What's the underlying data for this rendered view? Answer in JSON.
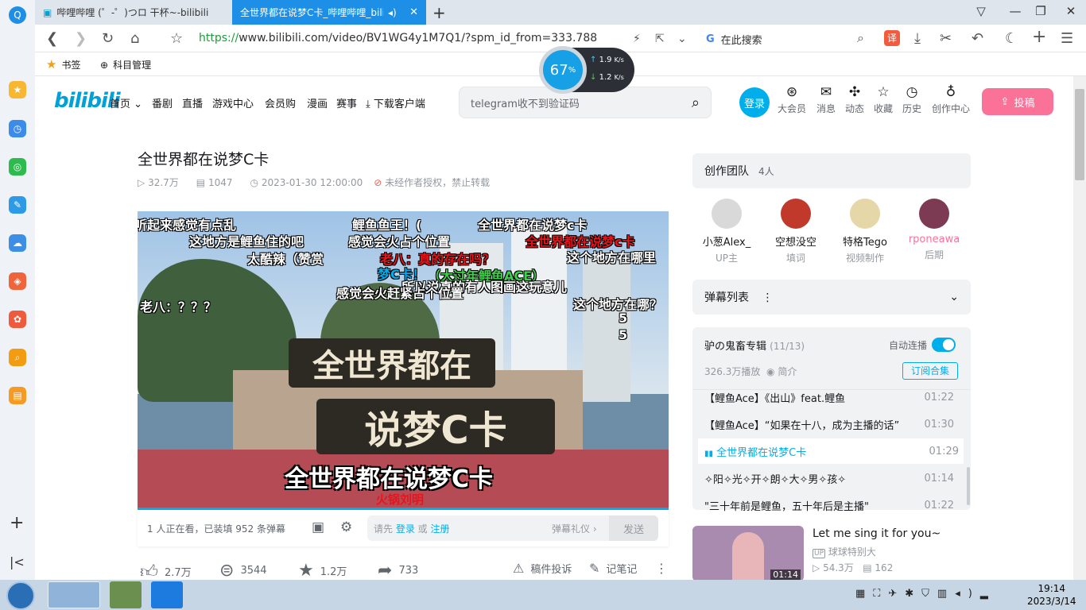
{
  "browser": {
    "tabs": [
      {
        "label": "哔哩哔哩 (゜-゜)つロ 干杯~-bilibili"
      },
      {
        "label": "全世界都在说梦C卡_哔哩哔哩_bilibili"
      }
    ],
    "url_prefix": "https://",
    "url_domain": "www.bilibili.com",
    "url_path": "/video/BV1WG4y1M7Q1/?spm_id_from=333.788",
    "search_placeholder": "在此搜索",
    "bookmarks": [
      {
        "label": "书签"
      },
      {
        "label": "科目管理"
      }
    ],
    "net_widget": {
      "percent": "67",
      "percent_sign": "%",
      "up": "1.9",
      "down": "1.2",
      "unit": "K/s"
    }
  },
  "bili_header": {
    "logo": "bilibili",
    "nav": [
      "首页",
      "番剧",
      "直播",
      "游戏中心",
      "会员购",
      "漫画",
      "赛事",
      "下载客户端"
    ],
    "search_placeholder": "telegram收不到验证码",
    "login": "登录",
    "icons": [
      "大会员",
      "消息",
      "动态",
      "收藏",
      "历史",
      "创作中心"
    ],
    "upload": "投稿"
  },
  "video": {
    "title": "全世界都在说梦C卡",
    "views": "32.7万",
    "danmaku_count": "1047",
    "date": "2023-01-30 12:00:00",
    "copyright": "未经作者授权，禁止转载",
    "danmaku": [
      {
        "text": "听起来感觉有点乱",
        "color": "#ffffff"
      },
      {
        "text": "鲤鱼鱼王！(",
        "color": "#ffffff"
      },
      {
        "text": "全世界都在说梦c卡",
        "color": "#ffffff"
      },
      {
        "text": "这地方是鲤鱼住的吧",
        "color": "#ffffff"
      },
      {
        "text": "感觉会火占个位置",
        "color": "#ffffff"
      },
      {
        "text": "全世界都在说梦c卡",
        "color": "#e8141b"
      },
      {
        "text": "太酷辣（赞赏",
        "color": "#ffffff"
      },
      {
        "text": "老八：真的存在吗？",
        "color": "#e8141b"
      },
      {
        "text": "这个地方在哪里",
        "color": "#ffffff"
      },
      {
        "text": "梦C卡！",
        "color": "#00aeec"
      },
      {
        "text": "（大过年鲤鱼ACE）",
        "color": "#3fd04b"
      },
      {
        "text": "所以说真的有人图画这玩意儿",
        "color": "#ffffff"
      },
      {
        "text": "感觉会火赶紧占个位置",
        "color": "#ffffff"
      },
      {
        "text": "老八：？？？",
        "color": "#ffffff"
      },
      {
        "text": "这个地方在哪？",
        "color": "#ffffff"
      },
      {
        "text": "5",
        "color": "#ffffff"
      },
      {
        "text": "5",
        "color": "#ffffff"
      }
    ],
    "sign_line1": "全世界都在",
    "sign_line2": "说梦C卡",
    "subtitle": "全世界都在说梦C卡",
    "subtitle2": "火锅刘明",
    "watching": "1 人正在看，已装填 952 条弹幕",
    "dm_prompt_prefix": "请先 ",
    "dm_login": "登录",
    "dm_or": " 或 ",
    "dm_register": "注册",
    "dm_etiquette": "弹幕礼仪 ›",
    "send": "发送",
    "likes": "2.7万",
    "coins": "3544",
    "favs": "1.2万",
    "shares": "733",
    "report": "稿件投诉",
    "notes": "记笔记"
  },
  "right": {
    "crew_title": "创作团队",
    "crew_count": "4人",
    "members": [
      {
        "name": "小葱Alex_",
        "role": "UP主",
        "color": "#333333"
      },
      {
        "name": "空想没空",
        "role": "填词",
        "color": "#333333"
      },
      {
        "name": "特格Tego",
        "role": "视频制作",
        "color": "#333333"
      },
      {
        "name": "rponeawa",
        "role": "后期",
        "color": "#fb7299"
      }
    ],
    "dm_list": "弹幕列表",
    "collection_title": "驴の鬼畜专辑",
    "collection_progress": "(11/13)",
    "autoplay": "自动连播",
    "collection_views": "326.3万播放",
    "intro": "简介",
    "subscribe": "订阅合集",
    "episodes": [
      {
        "title": "【鲤鱼Ace】《出山》feat.鲤鱼",
        "dur": "01:22"
      },
      {
        "title": "【鲤鱼Ace】“如果在十八，成为主播的话”",
        "dur": "01:30"
      },
      {
        "title": "全世界都在说梦C卡",
        "dur": "01:29"
      },
      {
        "title": "✧阳✧光✧开✧朗✧大✧男✧孩✧",
        "dur": "01:14"
      },
      {
        "title": "\"三十年前是鲤鱼，五十年后是主播\"",
        "dur": "01:22"
      }
    ],
    "rec": {
      "title": "Let me sing it for you~",
      "author": "球球特别大",
      "views": "54.3万",
      "dm": "162",
      "dur": "01:14"
    }
  },
  "taskbar": {
    "time": "19:14",
    "date": "2023/3/14"
  }
}
